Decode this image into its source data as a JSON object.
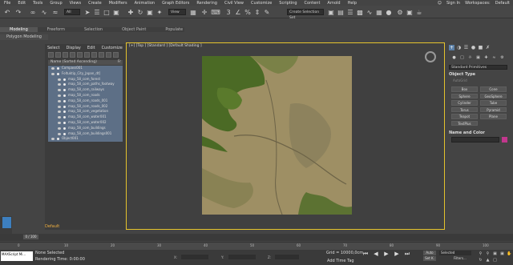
{
  "menu": [
    "File",
    "Edit",
    "Tools",
    "Group",
    "Views",
    "Create",
    "Modifiers",
    "Animation",
    "Graph Editors",
    "Rendering",
    "Civil View",
    "Customize",
    "Scripting",
    "Content",
    "Arnold",
    "Help"
  ],
  "account": {
    "label": "Sign In",
    "workspaces_label": "Workspaces:",
    "workspace": "Default"
  },
  "toolbar": {
    "view_dropdown": "View",
    "selection_set_dropdown": "Create Selection Set"
  },
  "ribbon": {
    "tabs": [
      "Modeling",
      "Freeform",
      "Selection",
      "Object Paint",
      "Populate"
    ],
    "active": "Modeling",
    "sub_label": "Polygon Modeling"
  },
  "explorer": {
    "menu": [
      "Select",
      "Display",
      "Edit",
      "Customize"
    ],
    "column_header": "Name (Sorted Ascending)",
    "column_frozen": "Fr",
    "rows": [
      {
        "label": "Compass001",
        "indent": 0,
        "selected": true
      },
      {
        "label": "Foltuktip_City_Japan_dt]",
        "indent": 0,
        "selected": true
      },
      {
        "label": "map_58_com_forest",
        "indent": 1,
        "selected": true
      },
      {
        "label": "map_58_com_paths_footway",
        "indent": 1,
        "selected": true
      },
      {
        "label": "map_58_com_railways",
        "indent": 1,
        "selected": true
      },
      {
        "label": "map_58_com_roads",
        "indent": 1,
        "selected": true
      },
      {
        "label": "map_58_com_roads_001",
        "indent": 1,
        "selected": true
      },
      {
        "label": "map_58_com_roads_002",
        "indent": 1,
        "selected": true
      },
      {
        "label": "map_58_com_vegetation",
        "indent": 1,
        "selected": true
      },
      {
        "label": "map_58_com_water001",
        "indent": 1,
        "selected": true
      },
      {
        "label": "map_58_com_water002",
        "indent": 1,
        "selected": true
      },
      {
        "label": "map_58_com_buildings",
        "indent": 1,
        "selected": true
      },
      {
        "label": "map_58_com_buildings001",
        "indent": 1,
        "selected": true
      },
      {
        "label": "Object001",
        "indent": 0,
        "selected": true
      }
    ],
    "layer_label": "Default"
  },
  "viewport": {
    "label": "[+] [Top ] [Standard ] [Default Shading ]"
  },
  "command_panel": {
    "dropdown": "Standard Primitives",
    "object_type_title": "Object Type",
    "autogrid": "AutoGrid",
    "object_types": [
      "Box",
      "Cone",
      "Sphere",
      "GeoSphere",
      "Cylinder",
      "Tube",
      "Torus",
      "Pyramid",
      "Teapot",
      "Plane",
      "TextPlus"
    ],
    "name_color_title": "Name and Color",
    "name_color_swatch": "#c2378d"
  },
  "timeline": {
    "slider": "0 / 100",
    "ticks": [
      "0",
      "10",
      "20",
      "30",
      "40",
      "50",
      "60",
      "70",
      "80",
      "90",
      "100"
    ]
  },
  "status": {
    "maxscript_placeholder": "MAXScript Mi...",
    "selection": "None Selected",
    "render_time": "Rendering Time: 0:00:00",
    "x_label": "X:",
    "y_label": "Y:",
    "z_label": "Z:",
    "grid": "Grid = 10000,0cm",
    "add_time_tag": "Add Time Tag",
    "auto_key": "Auto",
    "set_key": "Set K.",
    "selected_dropdown": "Selected",
    "filters": "Filters..."
  },
  "colors": {
    "viewport_border": "#e5c32d",
    "map_land": "#9e8f64",
    "map_vegetation": "#4b6a25",
    "selection_row": "#5d6f86"
  }
}
